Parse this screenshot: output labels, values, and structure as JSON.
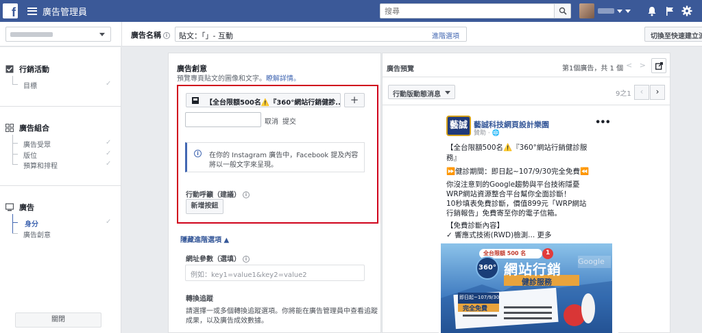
{
  "topbar": {
    "app_title": "廣告管理員",
    "search_placeholder": "搜尋",
    "icons": [
      "facebook-logo",
      "menu-icon",
      "search-icon",
      "bell-icon",
      "flag-icon",
      "gear-icon"
    ]
  },
  "subbar": {
    "ad_name_label": "廣告名稱",
    "ad_name_value": "貼文：「」- 互動",
    "ad_name_link": "進階選項",
    "quick_button": "切換至快速建立流"
  },
  "sidebar": {
    "campaign": {
      "title": "行銷活動",
      "items": [
        "目標"
      ]
    },
    "adset": {
      "title": "廣告組合",
      "items": [
        "廣告受眾",
        "版位",
        "預算和排程"
      ]
    },
    "ad": {
      "title": "廣告",
      "items": [
        "身分",
        "廣告創意"
      ]
    },
    "close_label": "關閉"
  },
  "main": {
    "title": "廣告創意",
    "desc": "預覽專頁貼文的圖像和文字。",
    "learn_more": "瞭解詳情。",
    "page_select": "【全台限額500名⚠️『360°網站行銷健診...",
    "plus": "+",
    "cancel": "取消",
    "submit": "提交",
    "notice_line1": "在你的 Instagram 廣告中，Facebook 提及內容",
    "notice_line2": "將以一般文字來呈現。",
    "notice_dots": "···",
    "cta_label": "行動呼籲（建議）",
    "cta_button": "新增按鈕",
    "advanced_link": "隱藏進階選項 ▲",
    "url_label": "網址參數（選填）",
    "url_placeholder": "例如：key1=value1&key2=value2",
    "tracking_label": "轉換追蹤",
    "tracking_desc1": "請選擇一或多個轉換追蹤選項。你將能在廣告管理員中查看追蹤",
    "tracking_desc2": "成果，以及廣告成效數據。"
  },
  "preview": {
    "title": "廣告預覽",
    "count": "第1個廣告，共 1 個",
    "placement_select": "行動版動態消息",
    "page_indicator": "9之1",
    "post": {
      "logo_text": "藝誠",
      "page_name": "藝誠科技網頁設計樂園",
      "sponsored": "贊助 · 🌐",
      "more": "•••",
      "lines": [
        "【全台限額500名⚠️『360°網站行銷健診服",
        "務』",
        "⏩健診期間：即日起~107/9/30完全免費⏪",
        "你沒注意到的Google趨勢與平台技術隱憂",
        "WRP網站資源整合平台幫你全面診斷！",
        "10秒填表免費診斷，價值899元「WRP網站",
        "行銷報告」免費寄至你的電子信箱。",
        "【免費診斷內容】",
        "✓ 響應式技術(RWD)檢測... 更多"
      ]
    },
    "banner": {
      "badge": "全台限額 500 名",
      "badge_num": "1",
      "circle": "360°",
      "headline": "網站行銷",
      "subhead": "健診服務",
      "google": "Google",
      "date": "即日起~107/9/30",
      "free": "完全免費"
    }
  },
  "colors": {
    "brand": "#3b5998",
    "link": "#4267b2",
    "highlight": "#d0021b"
  }
}
